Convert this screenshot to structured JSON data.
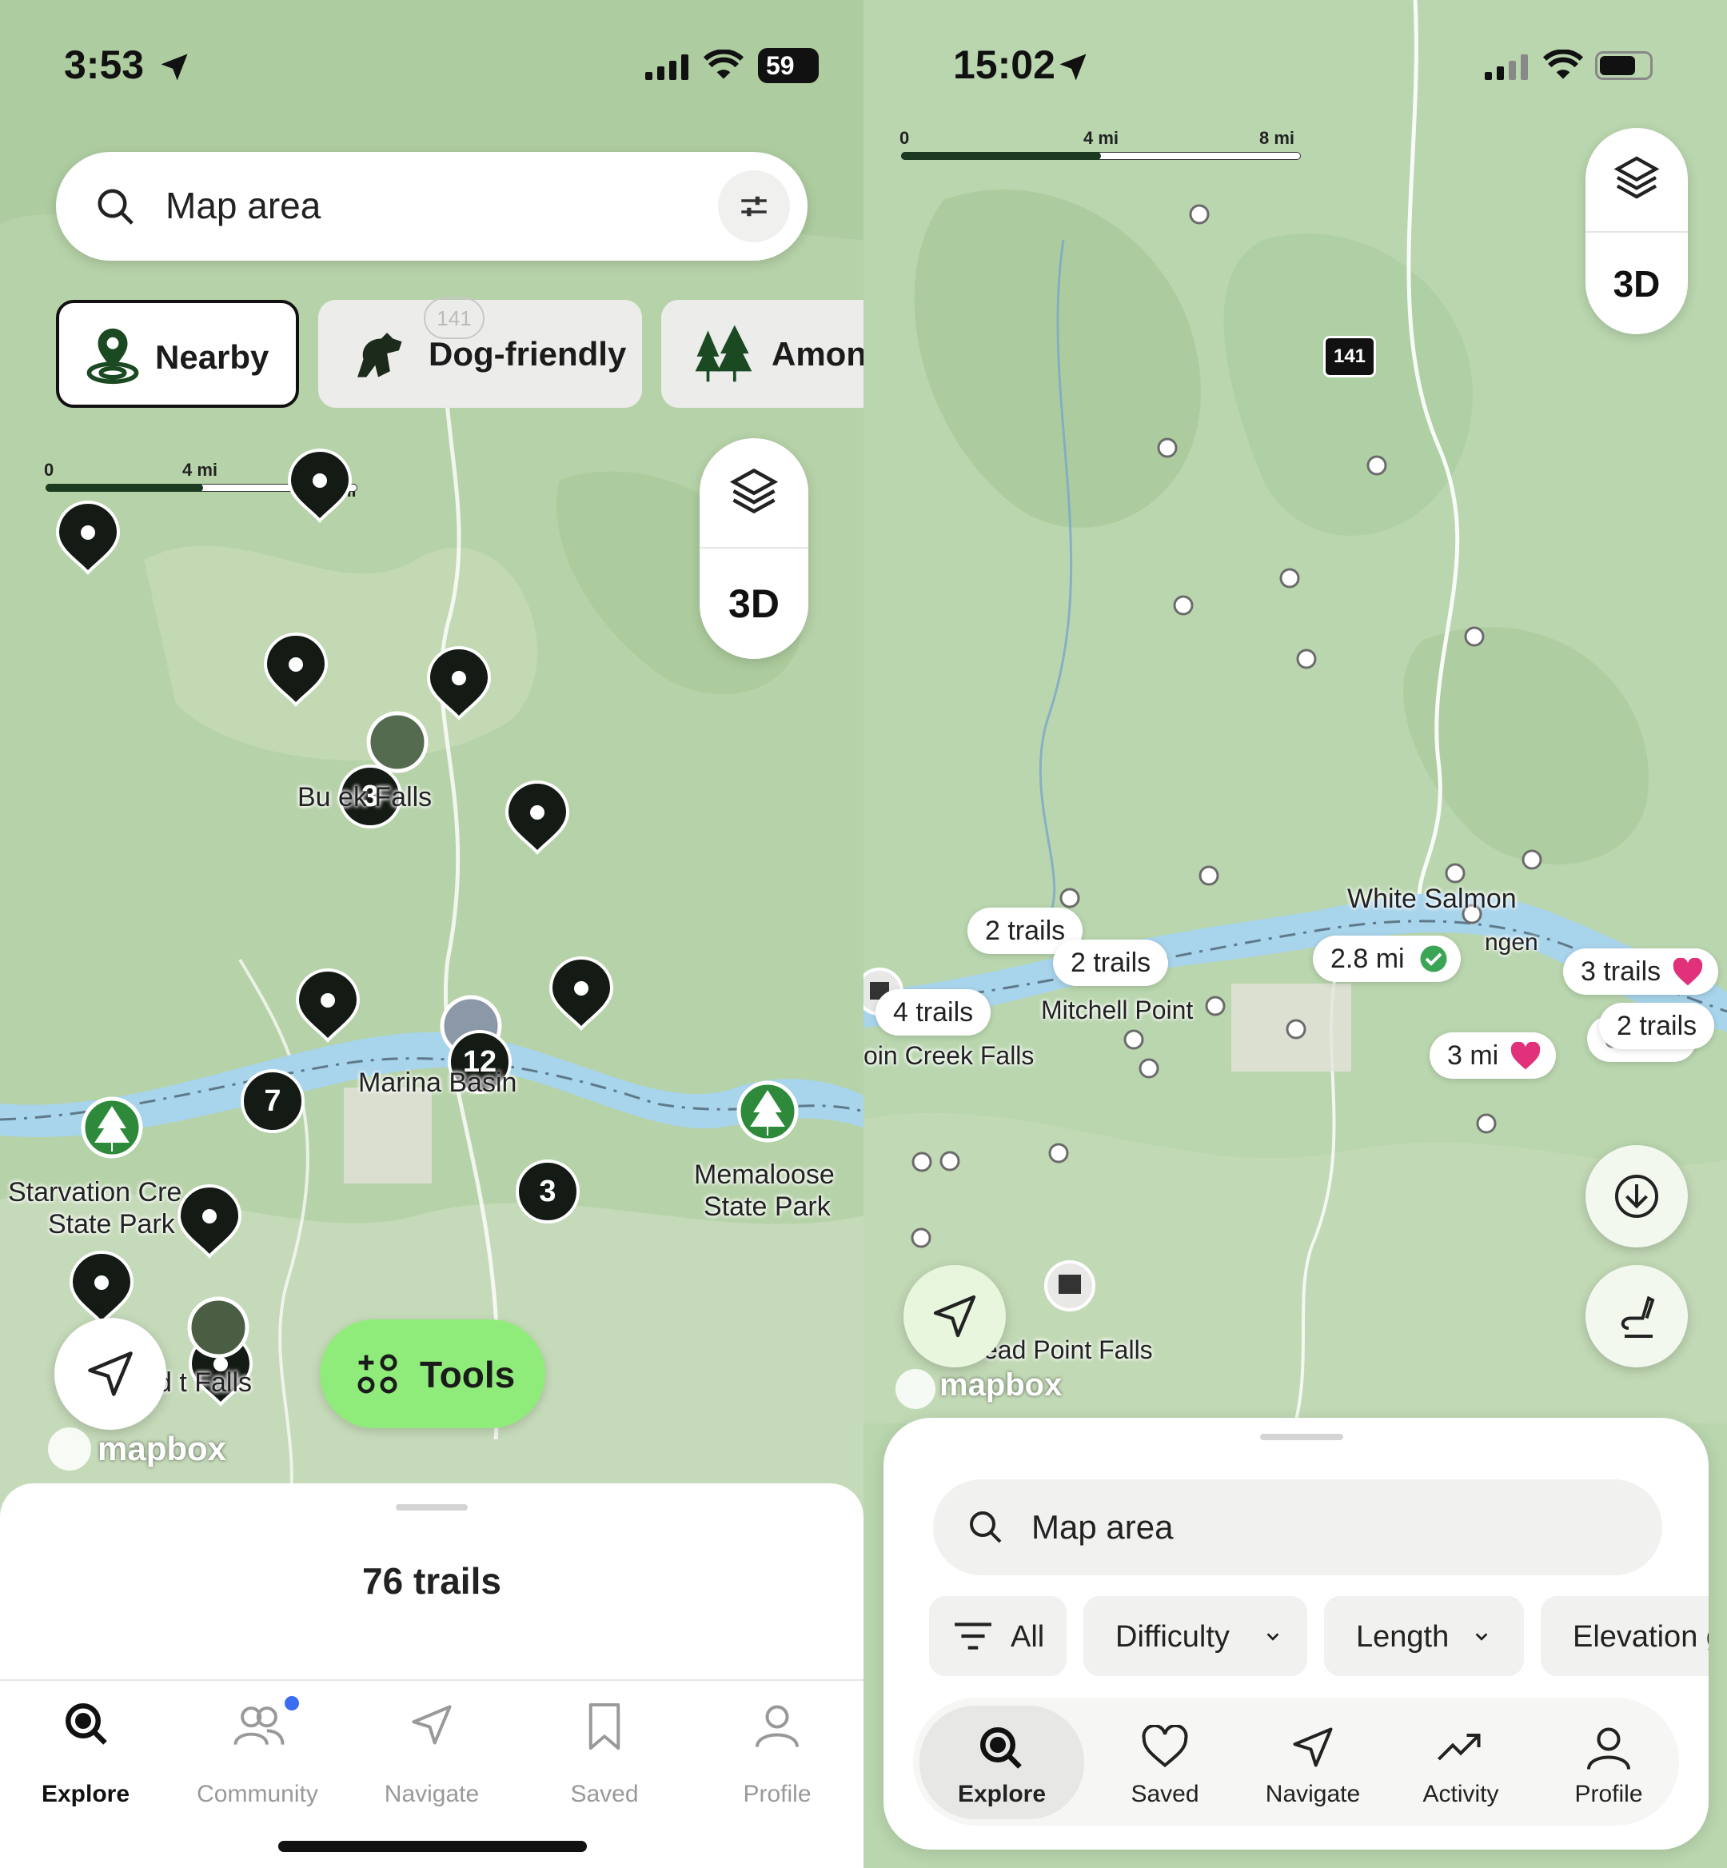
{
  "left": {
    "status": {
      "time": "3:53",
      "battery": "59"
    },
    "search": {
      "placeholder": "Map area"
    },
    "chips": [
      {
        "label": "Nearby",
        "icon": "nearby-pin-icon",
        "selected": true
      },
      {
        "label": "Dog-friendly",
        "icon": "dog-icon",
        "selected": false
      },
      {
        "label": "Amon",
        "icon": "trees-icon",
        "selected": false
      }
    ],
    "scale": {
      "start": "0",
      "mid": "4 mi",
      "end": "8 mi"
    },
    "layers_3d": "3D",
    "cluster_counts": [
      "3",
      "12",
      "7",
      "3"
    ],
    "map_labels": {
      "buck_creek": "Bu  ek Falls",
      "marina": "Marina     Basin",
      "starvation_1": "Starvation Cre",
      "starvation_2": "State Park",
      "memaloose_1": "Memaloose",
      "memaloose_2": "State Park",
      "falls": "d    t Falls",
      "shield": "141"
    },
    "tools": "Tools",
    "mapbox": "mapbox",
    "trail_count": "76 trails",
    "tabs": [
      {
        "label": "Explore",
        "icon": "explore-search-icon",
        "active": true
      },
      {
        "label": "Community",
        "icon": "community-icon",
        "active": false
      },
      {
        "label": "Navigate",
        "icon": "navigate-icon",
        "active": false
      },
      {
        "label": "Saved",
        "icon": "bookmark-icon",
        "active": false
      },
      {
        "label": "Profile",
        "icon": "profile-icon",
        "active": false
      }
    ]
  },
  "right": {
    "status": {
      "time": "15:02"
    },
    "scale": {
      "start": "0",
      "mid": "4 mi",
      "end": "8 mi"
    },
    "shield": "141",
    "layers_3d": "3D",
    "pills": {
      "two_trails_a": "2 trails",
      "two_trails_b": "2 trails",
      "four_trails": "4 trails",
      "distance_check": "2.8 mi",
      "three_trails": "3 trails",
      "two_trails_c": "2 trails",
      "three_mi": "3 mi",
      "partial": "3.7 mi"
    },
    "map_labels": {
      "white_salmon": "White Salmon",
      "bingen": "ngen",
      "mitchell": "Mitchell Point",
      "creek_falls": "oin Creek Falls",
      "dead_point": "ead Point Falls"
    },
    "mapbox": "mapbox",
    "search": {
      "placeholder": "Map area"
    },
    "filters": [
      {
        "label": "All",
        "icon": "filter-icon"
      },
      {
        "label": "Difficulty",
        "icon": "chevron-down-icon"
      },
      {
        "label": "Length",
        "icon": "chevron-down-icon"
      },
      {
        "label": "Elevation g",
        "icon": "chevron-down-icon"
      }
    ],
    "tabs": [
      {
        "label": "Explore",
        "icon": "explore-search-icon",
        "active": true
      },
      {
        "label": "Saved",
        "icon": "heart-icon",
        "active": false
      },
      {
        "label": "Navigate",
        "icon": "navigate-icon",
        "active": false
      },
      {
        "label": "Activity",
        "icon": "activity-icon",
        "active": false
      },
      {
        "label": "Profile",
        "icon": "profile-icon",
        "active": false
      }
    ],
    "colors": {
      "favorite": "#e0317a",
      "check": "#3aa655"
    }
  },
  "colors": {
    "accent_green": "#90ec7a",
    "river": "#a8d4ec",
    "map_bg": "#b5d3a8",
    "pin": "#141a14",
    "park_green": "#2e8a3a"
  }
}
